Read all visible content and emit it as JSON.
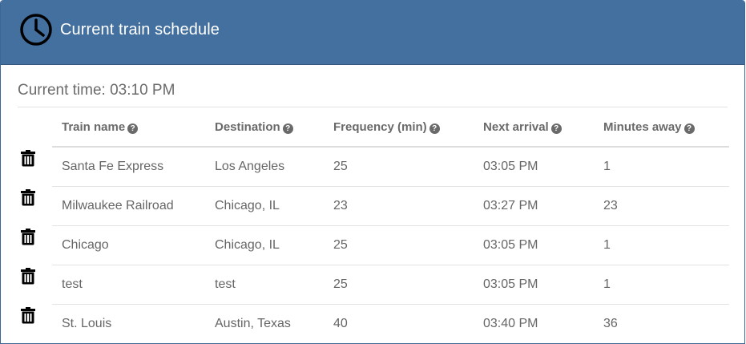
{
  "header": {
    "title": "Current train schedule",
    "icon": "clock-icon"
  },
  "current_time": "Current time: 03:10 PM",
  "table": {
    "columns": [
      "Train name",
      "Destination",
      "Frequency (min)",
      "Next arrival",
      "Minutes away"
    ],
    "rows": [
      {
        "name": "Santa Fe Express",
        "destination": "Los Angeles",
        "frequency": "25",
        "next_arrival": "03:05 PM",
        "minutes_away": "1"
      },
      {
        "name": "Milwaukee Railroad",
        "destination": "Chicago, IL",
        "frequency": "23",
        "next_arrival": "03:27 PM",
        "minutes_away": "23"
      },
      {
        "name": "Chicago",
        "destination": "Chicago, IL",
        "frequency": "25",
        "next_arrival": "03:05 PM",
        "minutes_away": "1"
      },
      {
        "name": "test",
        "destination": "test",
        "frequency": "25",
        "next_arrival": "03:05 PM",
        "minutes_away": "1"
      },
      {
        "name": "St. Louis",
        "destination": "Austin, Texas",
        "frequency": "40",
        "next_arrival": "03:40 PM",
        "minutes_away": "36"
      }
    ]
  },
  "colors": {
    "header_bg": "#44709f",
    "header_text": "#ffffff"
  }
}
